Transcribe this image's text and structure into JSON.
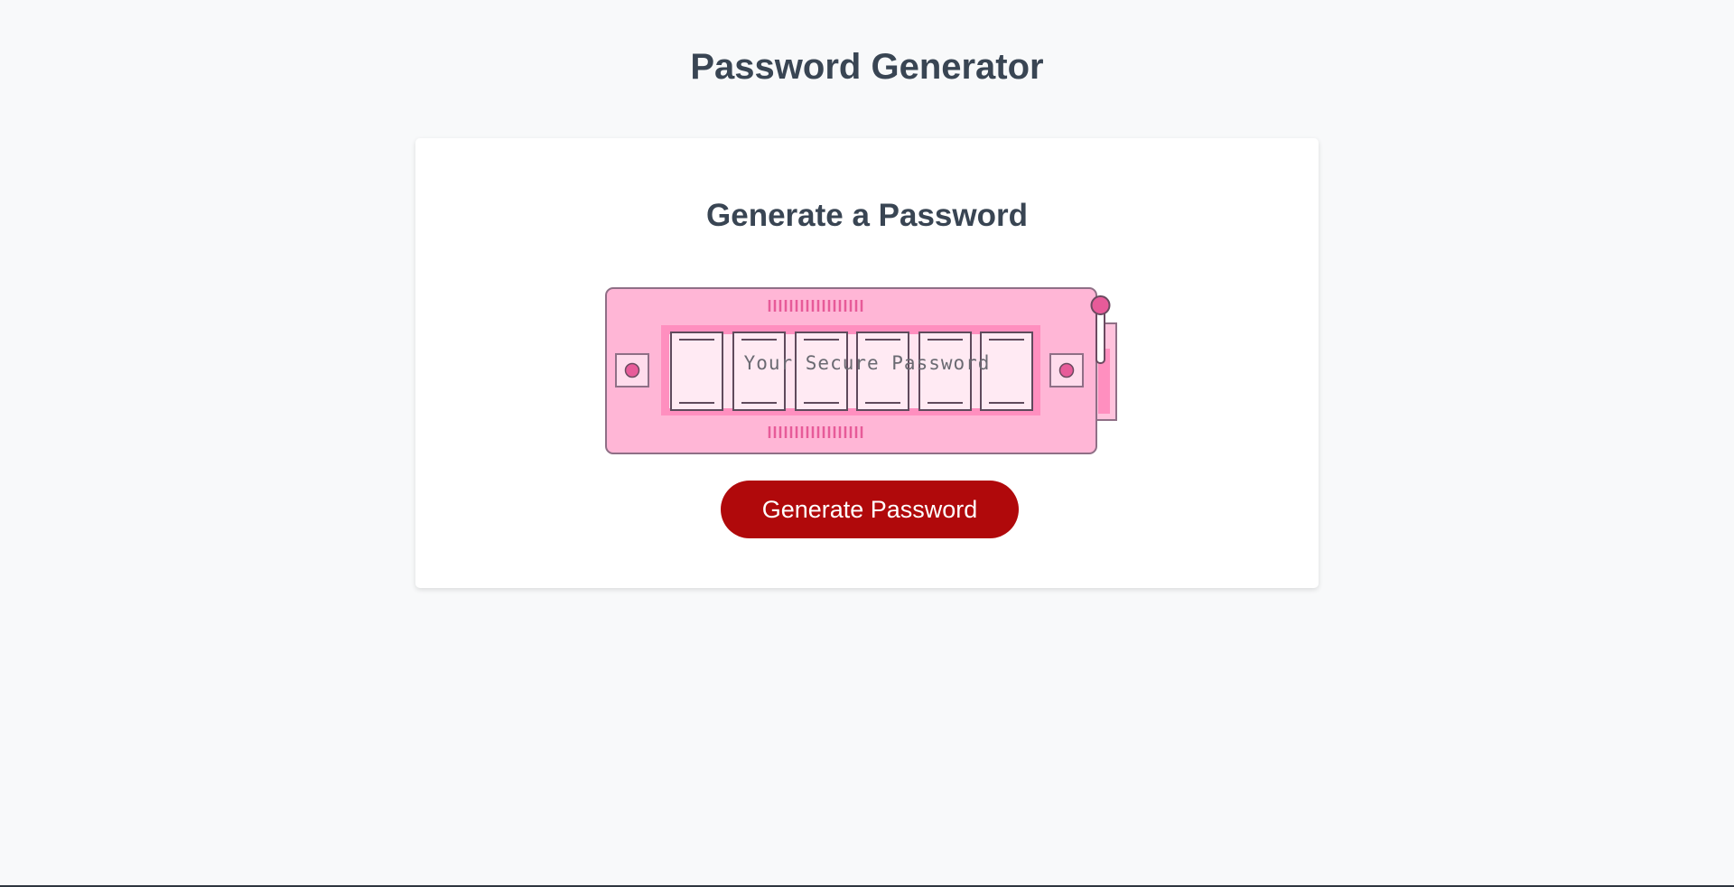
{
  "header": {
    "title": "Password Generator"
  },
  "card": {
    "title": "Generate a Password",
    "password_placeholder": "Your Secure Password",
    "generate_button_label": "Generate Password"
  },
  "colors": {
    "background": "#f8f9fa",
    "card": "#ffffff",
    "heading": "#394553",
    "button": "#b0090b",
    "machine_pink": "#ffb6d6",
    "machine_accent": "#e75b99"
  },
  "icons": {
    "illustration": "password-machine-icon",
    "lever": "lever-icon"
  }
}
